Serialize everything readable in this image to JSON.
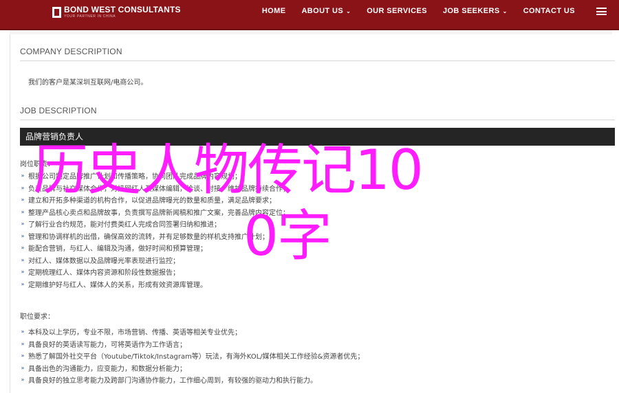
{
  "header": {
    "logo_name": "BOND WEST CONSULTANTS",
    "logo_tagline": "YOUR PARTNER IN CHINA",
    "nav": [
      {
        "label": "HOME",
        "dropdown": false
      },
      {
        "label": "ABOUT US",
        "dropdown": true
      },
      {
        "label": "OUR SERVICES",
        "dropdown": false
      },
      {
        "label": "JOB SEEKERS",
        "dropdown": true
      },
      {
        "label": "CONTACT US",
        "dropdown": false
      }
    ],
    "caret": "⌄",
    "menu_icon": "hamburger-icon",
    "bar_color": "#8a1318"
  },
  "company": {
    "title": "COMPANY DESCRIPTION",
    "text": "我们的客户是某深圳互联网/电商公司。"
  },
  "job": {
    "title": "JOB DESCRIPTION",
    "position": "品牌营销负责人",
    "duties_label": "岗位职责：",
    "duties": [
      "根据公司制定品牌推广计划和传播策略，协同团队完成品牌内容规划；",
      "负责品牌与社交媒体合作，对接网红人及媒体编辑，洽谈、对接、维护品牌持续合作；",
      "建立和开拓多种渠道的机构合作，以促进品牌曝光的数量和质量，满足品牌要求；",
      "整理产品核心卖点和品牌故事，负责撰写品牌新闻稿和推广文案，完善品牌内容定位；",
      "了解行业合约规范，能对付费类红人完成合同签署归纳和推进；",
      "管理和协调样机的出借，确保高效的流转，并有足够数量的样机支持推广计划；",
      "能配合营销，与红人、编辑及沟通，做好时间和预算管理；",
      "对红人、媒体数据以及品牌曝光率表现进行监控；",
      "定期梳理红人、媒体内容资源和阶段性数据报告；",
      "定期维护好与红人、媒体人的关系，形成有效资源库管理。"
    ],
    "requirements_label": "职位要求：",
    "requirements": [
      "本科及以上学历，专业不限，市场营销、传播、英语等相关专业优先；",
      "具备良好的英语读写能力，可将英语作为工作语言；",
      "熟悉了解国外社交平台（Youtube/Tiktok/Instagram等）玩法，有海外KOL/媒体相关工作经验&资源者优先；",
      "具备出色的沟通能力，应变能力，和数据分析能力；",
      "具备良好的独立思考能力及跨部门沟通协作能力，工作细心周到，有较强的驱动力和执行能力。"
    ],
    "bullet": "»"
  },
  "overlay": {
    "line1": "历史人物传记10",
    "line2": "0字",
    "color": "#ff1dff"
  }
}
